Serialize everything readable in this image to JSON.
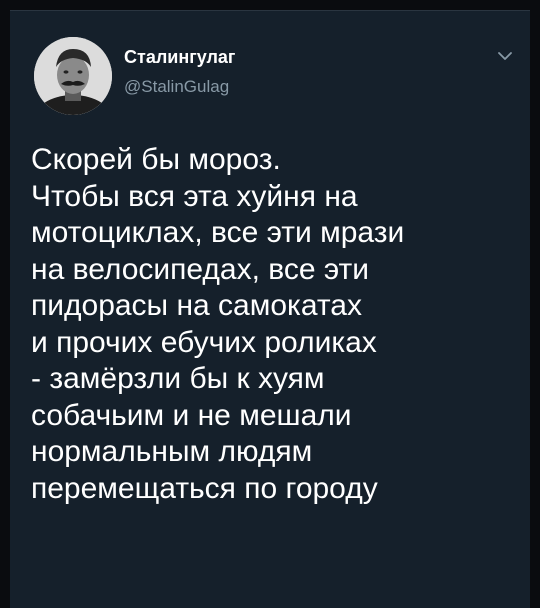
{
  "author": {
    "name": "Сталингулаг",
    "handle": "@StalinGulag"
  },
  "icons": {
    "avatar": "avatar-portrait",
    "caret": "chevron-down-icon"
  },
  "colors": {
    "background": "#15202b",
    "text": "#ffffff",
    "secondary_text": "#8899a6"
  },
  "tweet": {
    "lines": [
      "Скорей бы мороз.",
      "Чтобы вся эта хуйня на",
      "мотоциклах, все эти мрази",
      "на велосипедах, все эти",
      "пидорасы на самокатах",
      "и прочих ебучих роликах",
      "- замёрзли бы к хуям",
      "собачьим и не мешали",
      "нормальным людям",
      "перемещаться по городу"
    ]
  }
}
